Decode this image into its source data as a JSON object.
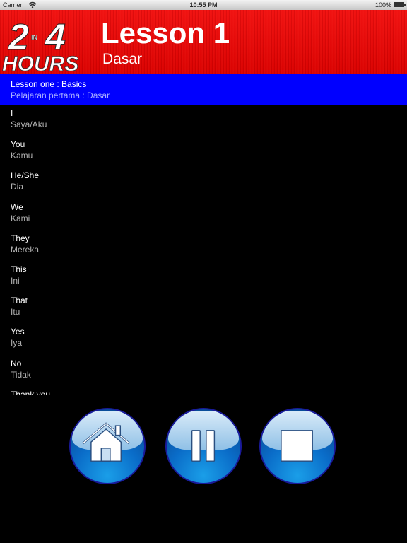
{
  "status_bar": {
    "carrier": "Carrier",
    "time": "10:55 PM",
    "battery": "100%"
  },
  "header": {
    "logo": {
      "number": "24",
      "small": "IN",
      "word": "HOURS"
    },
    "title": "Lesson 1",
    "subtitle": "Dasar"
  },
  "lesson_info": {
    "english": "Lesson one : Basics",
    "indonesian": "Pelajaran pertama : Dasar"
  },
  "words": [
    {
      "english": "I",
      "indonesian": "Saya/Aku"
    },
    {
      "english": "You",
      "indonesian": "Kamu"
    },
    {
      "english": "He/She",
      "indonesian": "Dia"
    },
    {
      "english": "We",
      "indonesian": "Kami"
    },
    {
      "english": "They",
      "indonesian": "Mereka"
    },
    {
      "english": "This",
      "indonesian": "Ini"
    },
    {
      "english": "That",
      "indonesian": "Itu"
    },
    {
      "english": "Yes",
      "indonesian": "Iya"
    },
    {
      "english": "No",
      "indonesian": "Tidak"
    },
    {
      "english": "Thank you",
      "indonesian": ""
    }
  ],
  "controls": {
    "home_icon": "home-icon",
    "pause_icon": "pause-icon",
    "stop_icon": "stop-icon"
  },
  "colors": {
    "header_red": "#e80000",
    "info_blue": "#0000ff",
    "button_blue": "#0a6cc8"
  }
}
